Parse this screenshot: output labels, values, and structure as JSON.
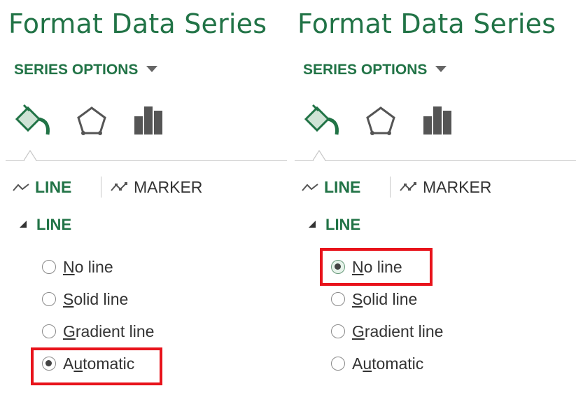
{
  "panels": [
    {
      "title": "Format Data Series",
      "series_options": "SERIES OPTIONS",
      "tabs": {
        "line": "LINE",
        "marker": "MARKER"
      },
      "section": "LINE",
      "options": [
        {
          "pre": "",
          "u": "N",
          "post": "o line",
          "selected": false
        },
        {
          "pre": "",
          "u": "S",
          "post": "olid line",
          "selected": false
        },
        {
          "pre": "",
          "u": "G",
          "post": "radient line",
          "selected": false
        },
        {
          "pre": "A",
          "u": "u",
          "post": "tomatic",
          "selected": true
        }
      ],
      "highlighted_option": "Automatic"
    },
    {
      "title": "Format Data Series",
      "series_options": "SERIES OPTIONS",
      "tabs": {
        "line": "LINE",
        "marker": "MARKER"
      },
      "section": "LINE",
      "options": [
        {
          "pre": "",
          "u": "N",
          "post": "o line",
          "selected": true
        },
        {
          "pre": "",
          "u": "S",
          "post": "olid line",
          "selected": false
        },
        {
          "pre": "",
          "u": "G",
          "post": "radient line",
          "selected": false
        },
        {
          "pre": "A",
          "u": "u",
          "post": "tomatic",
          "selected": false
        }
      ],
      "highlighted_option": "No line"
    }
  ],
  "colors": {
    "accent": "#217346",
    "highlight": "#e8131b",
    "text": "#333333"
  },
  "icons": [
    "fill-line-icon",
    "effects-pentagon-icon",
    "series-options-bar-icon",
    "line-tab-icon",
    "marker-tab-icon",
    "dropdown-caret-icon",
    "collapse-triangle-icon"
  ]
}
